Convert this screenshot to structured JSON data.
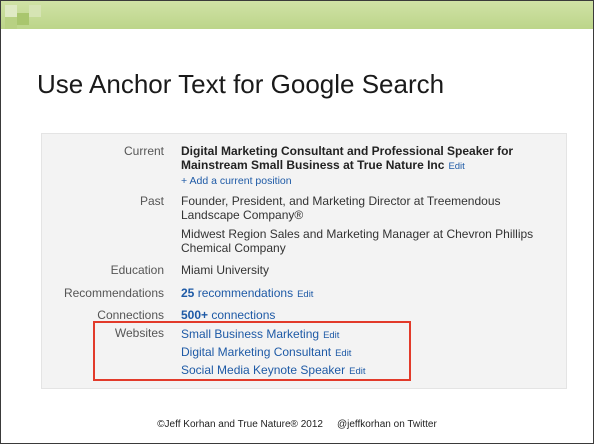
{
  "slide": {
    "title": "Use Anchor Text for Google Search",
    "footer": {
      "copyright": "©Jeff Korhan and True Nature® 2012",
      "twitter": "@jeffkorhan on Twitter"
    }
  },
  "profile": {
    "current": {
      "label": "Current",
      "title_line1": "Digital Marketing Consultant and Professional Speaker for",
      "title_line2": "Mainstream Small Business",
      "at": " at ",
      "company": "True Nature Inc",
      "edit": "Edit",
      "add_position": "+ Add a current position"
    },
    "past": {
      "label": "Past",
      "items": [
        {
          "line1": "Founder, President, and Marketing Director at Treemendous",
          "line2": "Landscape Company®"
        },
        {
          "line1": "Midwest Region Sales and Marketing Manager at Chevron Phillips",
          "line2": "Chemical Company"
        }
      ]
    },
    "education": {
      "label": "Education",
      "value": "Miami University"
    },
    "recommendations": {
      "label": "Recommendations",
      "count": "25",
      "text": " recommendations",
      "edit": "Edit"
    },
    "connections": {
      "label": "Connections",
      "count": "500+",
      "text": " connections"
    },
    "websites": {
      "label": "Websites",
      "items": [
        {
          "text": "Small Business Marketing",
          "edit": "Edit"
        },
        {
          "text": "Digital Marketing Consultant",
          "edit": "Edit"
        },
        {
          "text": "Social Media Keynote Speaker",
          "edit": "Edit"
        }
      ]
    }
  },
  "colors": {
    "accent_bar": "#c7dc98",
    "accent_square_light": "#dde9c2",
    "accent_square_dark": "#a6c46a",
    "link": "#1e5aa6",
    "highlight_border": "#e23a2a",
    "panel_bg": "#f3f3f3"
  }
}
